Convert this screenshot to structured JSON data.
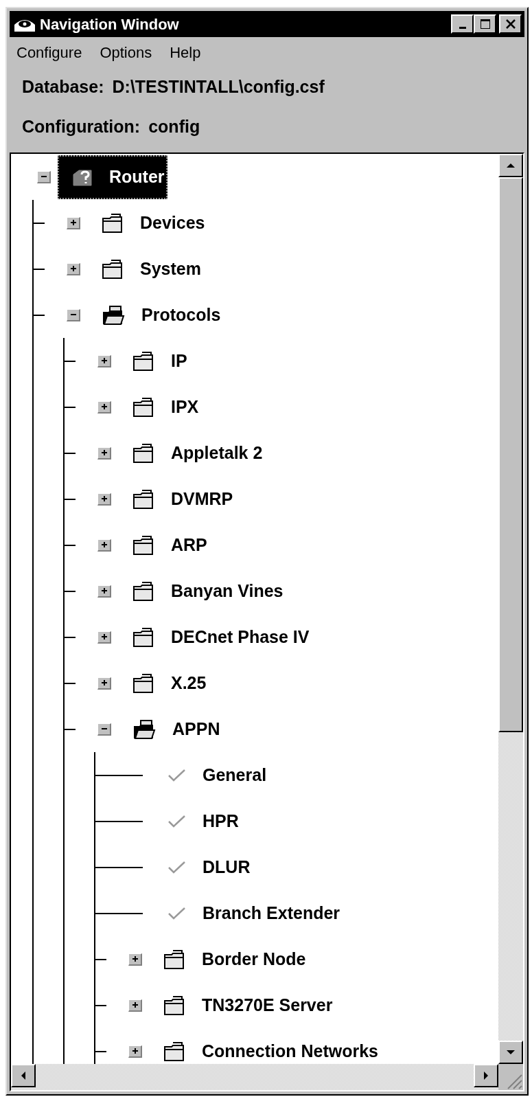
{
  "window": {
    "title": "Navigation Window"
  },
  "menu": [
    "Configure",
    "Options",
    "Help"
  ],
  "info": [
    {
      "label": "Database:",
      "value": "D:\\TESTINTALL\\config.csf"
    },
    {
      "label": "Configuration:",
      "value": "config"
    }
  ],
  "tree": [
    {
      "label": "Router",
      "kind": "device",
      "expanded": true,
      "selected": true,
      "children": [
        {
          "label": "Devices",
          "kind": "folder",
          "expanded": false,
          "selected": false
        },
        {
          "label": "System",
          "kind": "folder",
          "expanded": false,
          "selected": false
        },
        {
          "label": "Protocols",
          "kind": "folder",
          "expanded": true,
          "selected": false,
          "children": [
            {
              "label": "IP",
              "kind": "folder",
              "expanded": false,
              "selected": false
            },
            {
              "label": "IPX",
              "kind": "folder",
              "expanded": false,
              "selected": false
            },
            {
              "label": "Appletalk 2",
              "kind": "folder",
              "expanded": false,
              "selected": false
            },
            {
              "label": "DVMRP",
              "kind": "folder",
              "expanded": false,
              "selected": false
            },
            {
              "label": "ARP",
              "kind": "folder",
              "expanded": false,
              "selected": false
            },
            {
              "label": "Banyan Vines",
              "kind": "folder",
              "expanded": false,
              "selected": false
            },
            {
              "label": "DECnet Phase IV",
              "kind": "folder",
              "expanded": false,
              "selected": false
            },
            {
              "label": "X.25",
              "kind": "folder",
              "expanded": false,
              "selected": false
            },
            {
              "label": "APPN",
              "kind": "folder",
              "expanded": true,
              "selected": false,
              "children": [
                {
                  "label": "General",
                  "kind": "setting",
                  "checked": true,
                  "selected": false
                },
                {
                  "label": "HPR",
                  "kind": "setting",
                  "checked": true,
                  "selected": false
                },
                {
                  "label": "DLUR",
                  "kind": "setting",
                  "checked": true,
                  "selected": false
                },
                {
                  "label": "Branch Extender",
                  "kind": "setting",
                  "checked": true,
                  "selected": false
                },
                {
                  "label": "Border Node",
                  "kind": "folder",
                  "expanded": false,
                  "selected": false
                },
                {
                  "label": "TN3270E Server",
                  "kind": "folder",
                  "expanded": false,
                  "selected": false
                },
                {
                  "label": "Connection Networks",
                  "kind": "folder",
                  "expanded": false,
                  "selected": false
                }
              ]
            }
          ]
        }
      ]
    }
  ]
}
